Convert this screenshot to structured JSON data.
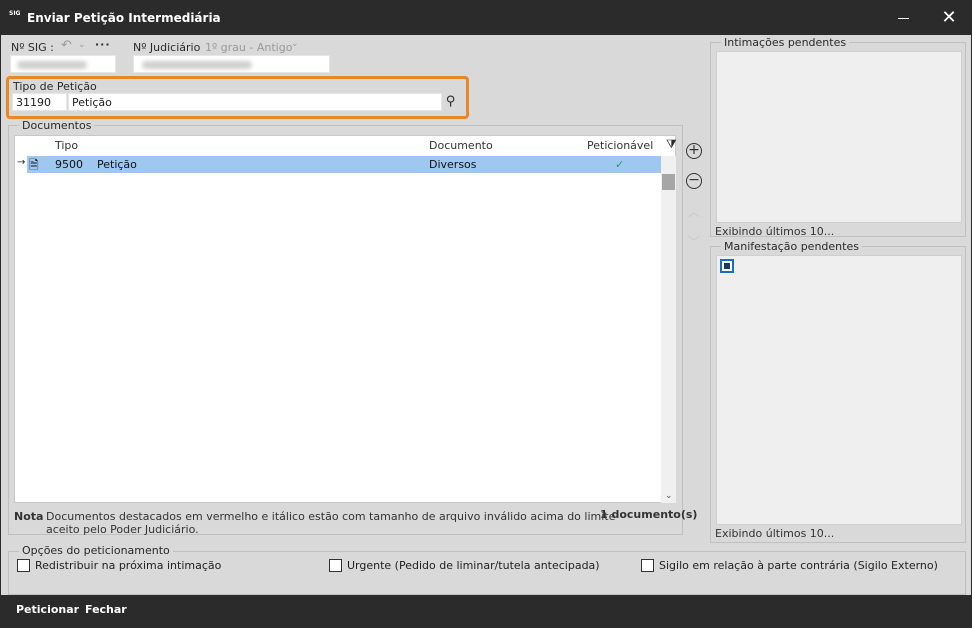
{
  "window": {
    "title": "Enviar Petição Intermediária",
    "app_icon_text": "SIG"
  },
  "header": {
    "sig_label": "Nº SIG :",
    "judiciario_label": "Nº Judiciário",
    "grau_label": "1º grau - Antigo"
  },
  "tipo_peticao": {
    "label": "Tipo de Petição",
    "code": "31190",
    "description": "Petição"
  },
  "documentos": {
    "group_label": "Documentos",
    "columns": [
      "Tipo",
      "Documento",
      "Peticionável"
    ],
    "rows": [
      {
        "codigo": "9500",
        "tipo": "Petição",
        "documento": "Diversos",
        "peticionavel": "✓"
      }
    ],
    "nota_label": "Nota",
    "nota_text_1": "Documentos destacados em vermelho e itálico estão com tamanho de arquivo inválido acima do limite",
    "nota_text_2": "aceito pelo Poder Judiciário.",
    "count": "1 documento(s)"
  },
  "intimacoes": {
    "label": "Intimações pendentes",
    "footer": "Exibindo últimos 10..."
  },
  "manifestacao": {
    "label": "Manifestação pendentes",
    "footer": "Exibindo últimos 10..."
  },
  "opcoes": {
    "label": "Opções do peticionamento",
    "redistribuir": "Redistribuir na próxima intimação",
    "urgente": "Urgente (Pedido de liminar/tutela antecipada)",
    "sigilo": "Sigilo em relação à parte contrária (Sigilo Externo)"
  },
  "footer": {
    "peticionar": "Peticionar",
    "fechar": "Fechar"
  },
  "colors": {
    "highlight": "#e8882a",
    "selected_row": "#9ec8f0",
    "check_green": "#2e9d3f",
    "titlebar": "#2b2b2b"
  }
}
